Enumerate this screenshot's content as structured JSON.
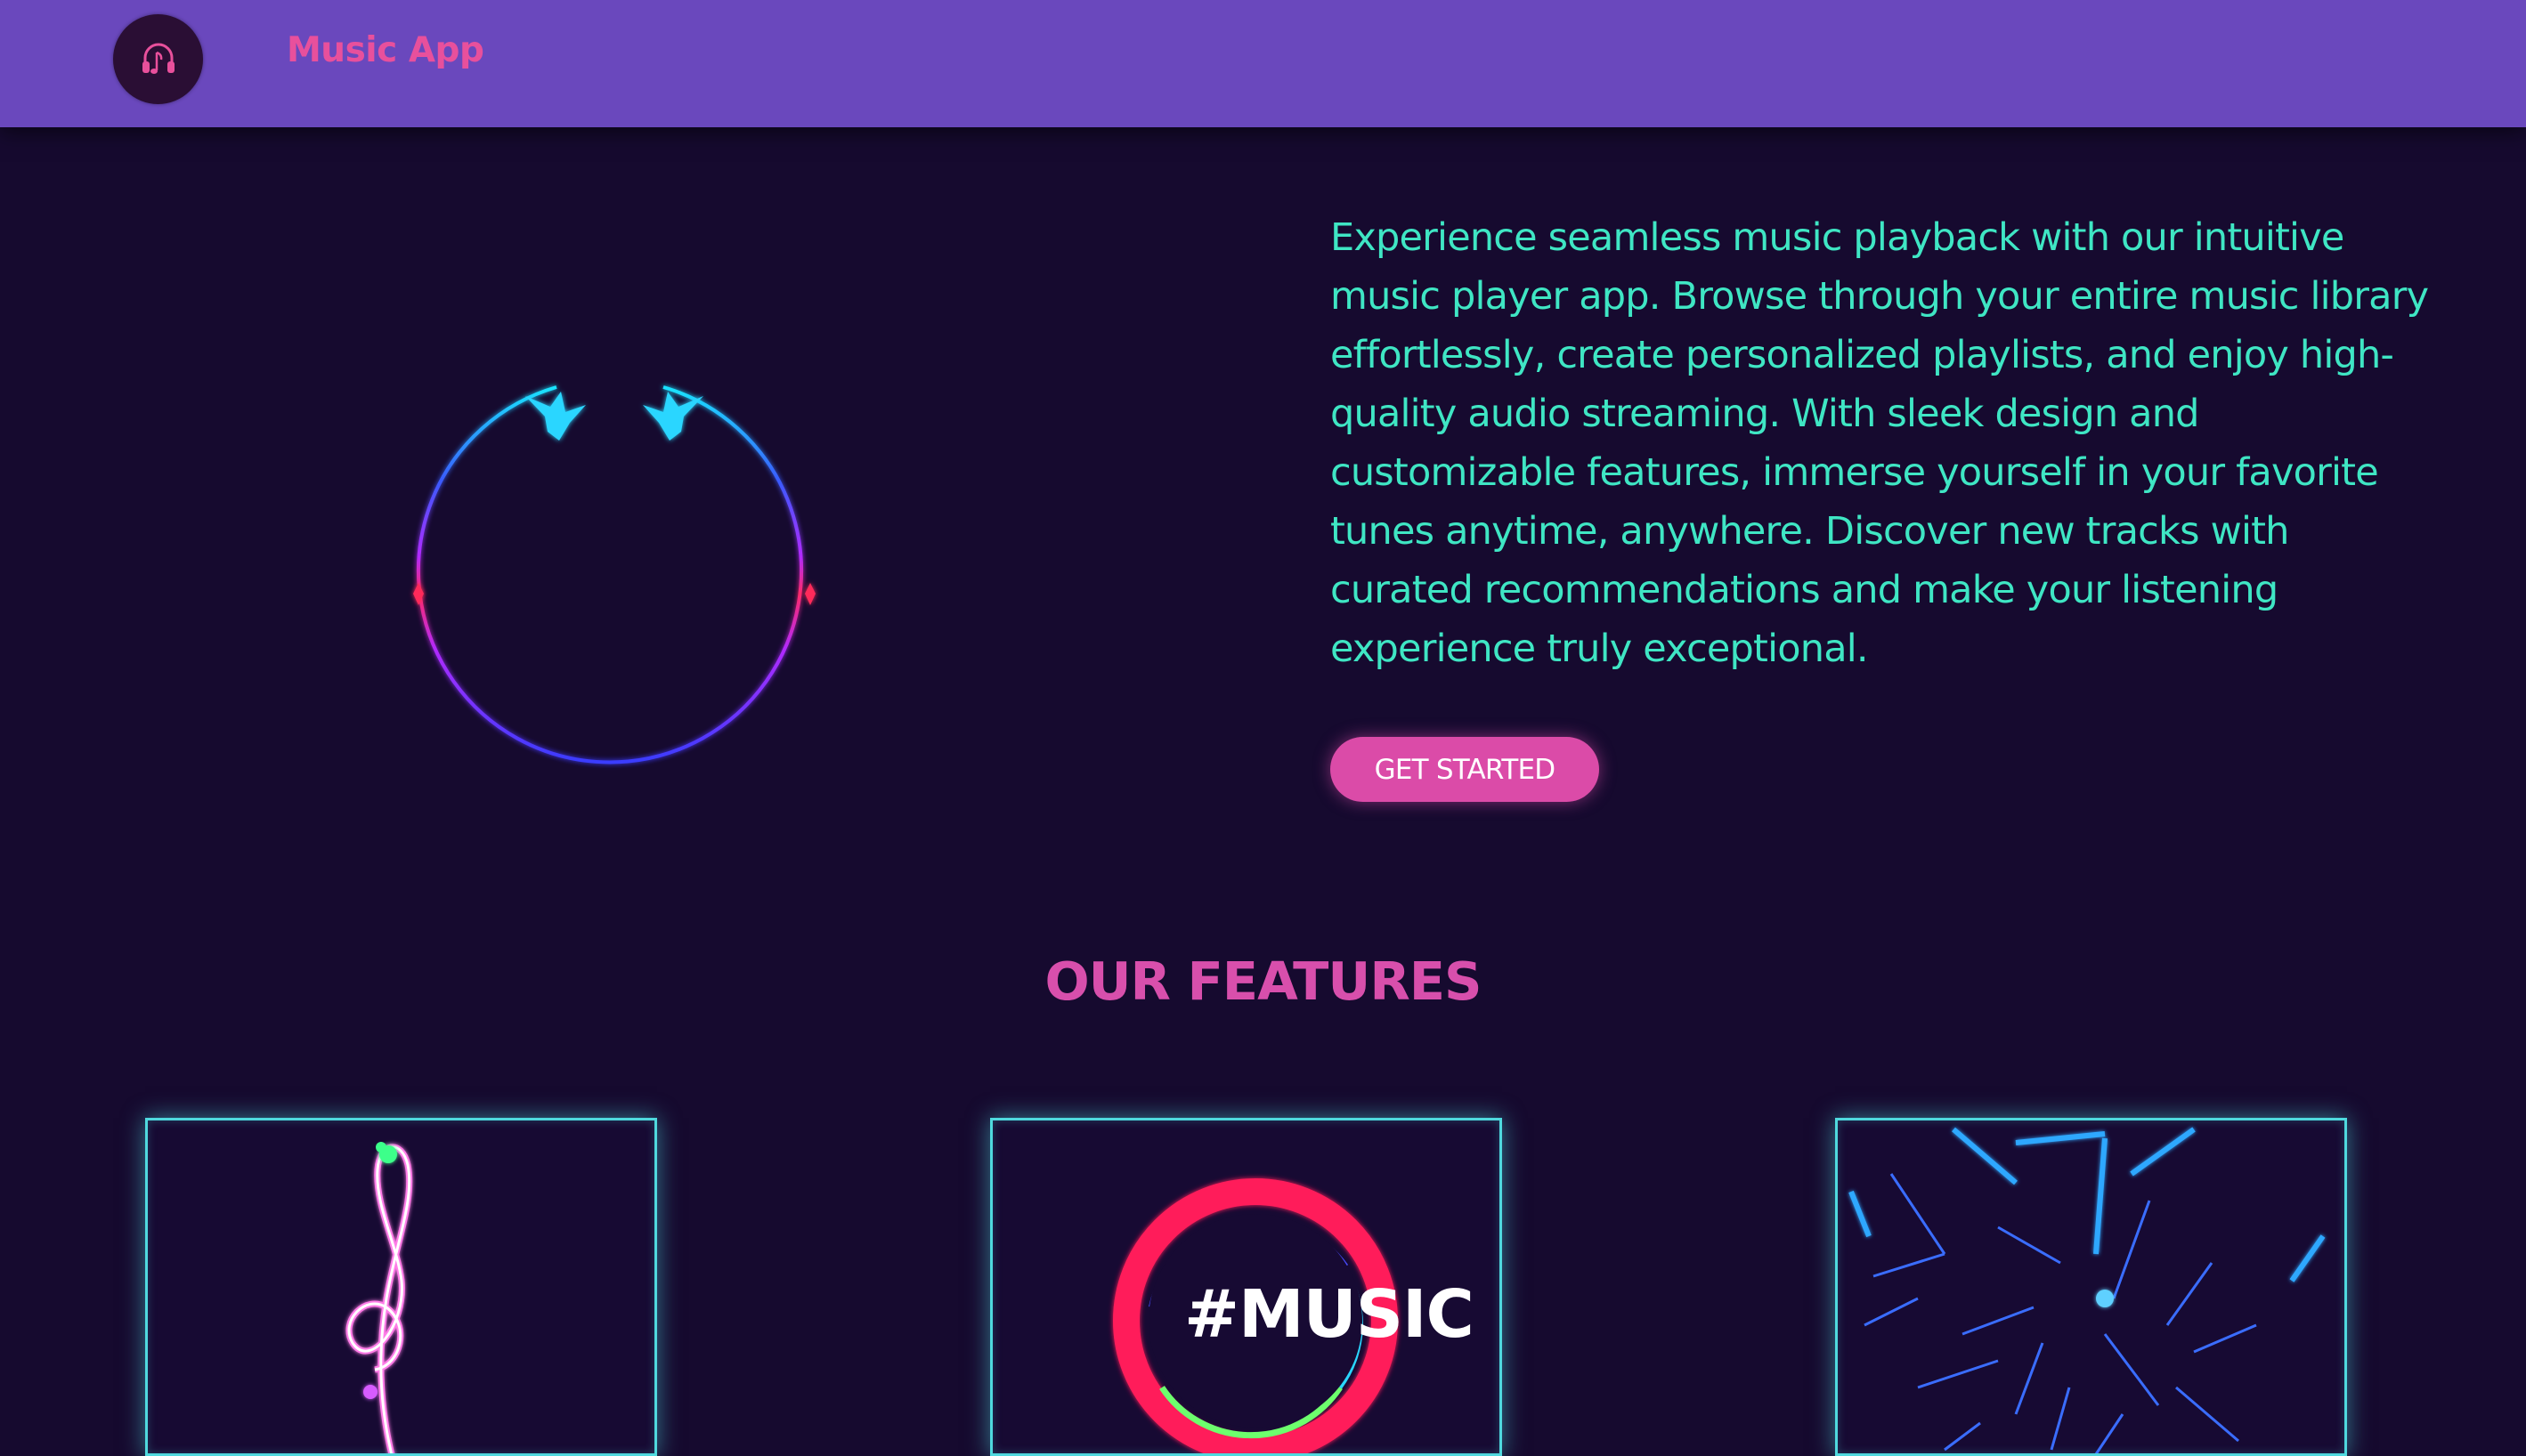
{
  "navbar": {
    "logo_icon": "headphones-music-note-icon",
    "brand": "Music App"
  },
  "hero": {
    "visual": "circular-audio-visualizer",
    "description": "Experience seamless music playback with our intuitive music player app. Browse through your entire music library effortlessly, create personalized playlists, and enjoy high-quality audio streaming. With sleek design and customizable features, immerse yourself in your favorite tunes anytime, anywhere. Discover new tracks with curated recommendations and make your listening experience truly exceptional.",
    "cta_label": "GET STARTED"
  },
  "features": {
    "title": "OUR FEATURES",
    "cards": [
      {
        "image": "neon-treble-clef"
      },
      {
        "image": "neon-music-ring",
        "overlay_text": "#MUSIC"
      },
      {
        "image": "neon-light-streaks"
      }
    ]
  },
  "colors": {
    "background": "#160a2f",
    "navbar": "#6a48bd",
    "accent_pink": "#db4ba8",
    "text_teal": "#3fe6c4",
    "card_border": "#4fd9de"
  }
}
